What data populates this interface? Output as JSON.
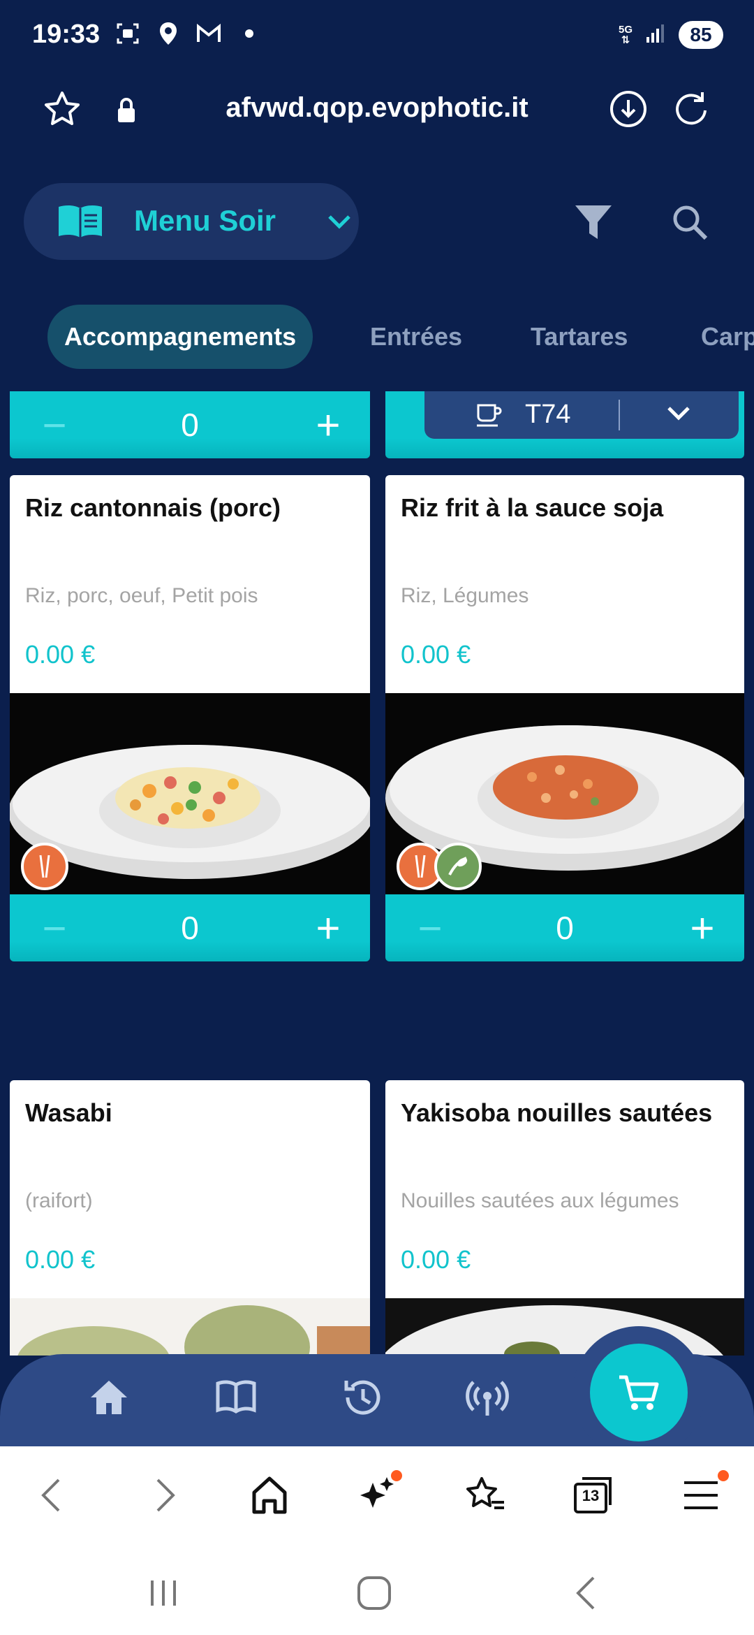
{
  "status": {
    "time": "19:33",
    "network": "5G",
    "battery": "85"
  },
  "browser": {
    "url": "afvwd.qop.evophotic.it",
    "tab_count": "13"
  },
  "menu": {
    "selected": "Menu Soir"
  },
  "tabs": [
    "Accompagnements",
    "Entrées",
    "Tartares",
    "Carp"
  ],
  "table": {
    "label": "T74"
  },
  "top_strip": {
    "quantity": "0"
  },
  "items": [
    {
      "title": "Riz cantonnais (porc)",
      "description": "Riz, porc, oeuf, Petit pois",
      "price": "0.00 €",
      "quantity": "0",
      "badges": [
        "chopsticks-icon"
      ]
    },
    {
      "title": "Riz frit à la sauce soja",
      "description": "Riz, Légumes",
      "price": "0.00 €",
      "quantity": "0",
      "badges": [
        "chopsticks-icon",
        "vegetarian-icon"
      ]
    },
    {
      "title": "Wasabi",
      "description": "(raifort)",
      "price": "0.00 €"
    },
    {
      "title": "Yakisoba nouilles sautées",
      "description": "Nouilles sautées aux légumes",
      "price": "0.00 €"
    }
  ],
  "colors": {
    "background": "#0b1f4d",
    "accent": "#0cc7cf",
    "nav": "#2e4a86",
    "badge_orange": "#e9703e",
    "badge_green": "#6f9f5a",
    "notification_dot": "#ff5a1f"
  }
}
